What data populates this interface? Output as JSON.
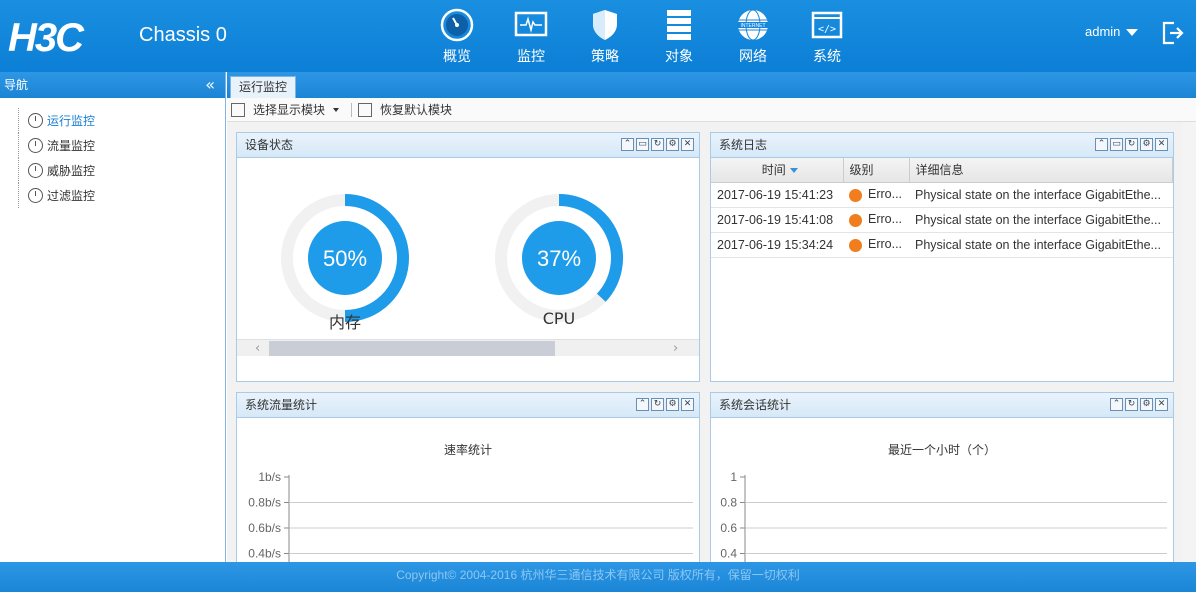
{
  "header": {
    "logo": "H3C",
    "chassis": "Chassis 0",
    "user": "admin",
    "nav": [
      {
        "label": "概览",
        "icon": "gauge-icon"
      },
      {
        "label": "监控",
        "icon": "monitor-icon"
      },
      {
        "label": "策略",
        "icon": "shield-icon"
      },
      {
        "label": "对象",
        "icon": "server-icon"
      },
      {
        "label": "网络",
        "icon": "internet-icon"
      },
      {
        "label": "系统",
        "icon": "code-window-icon"
      }
    ],
    "internet_icon_text": "INTERNET"
  },
  "sidebar": {
    "title": "导航",
    "collapse": "«",
    "items": [
      {
        "label": "运行监控",
        "active": true
      },
      {
        "label": "流量监控",
        "active": false
      },
      {
        "label": "威胁监控",
        "active": false
      },
      {
        "label": "过滤监控",
        "active": false
      }
    ]
  },
  "main": {
    "tab": "运行监控",
    "toolbar": {
      "select_modules": "选择显示模块",
      "restore_default": "恢复默认模块"
    }
  },
  "device_status": {
    "title": "设备状态",
    "gauges": [
      {
        "label": "内存",
        "value": 50,
        "text": "50%"
      },
      {
        "label": "CPU",
        "value": 37,
        "text": "37%"
      }
    ]
  },
  "system_log": {
    "title": "系统日志",
    "columns": [
      "时间",
      "级别",
      "详细信息"
    ],
    "rows": [
      {
        "time": "2017-06-19 15:41:23",
        "level": "Erro...",
        "detail": "Physical state on the interface GigabitEthe..."
      },
      {
        "time": "2017-06-19 15:41:08",
        "level": "Erro...",
        "detail": "Physical state on the interface GigabitEthe..."
      },
      {
        "time": "2017-06-19 15:34:24",
        "level": "Erro...",
        "detail": "Physical state on the interface GigabitEthe..."
      }
    ]
  },
  "traffic_stats": {
    "title": "系统流量统计",
    "chart_title": "速率统计",
    "ticks": [
      "1b/s",
      "0.8b/s",
      "0.6b/s",
      "0.4b/s"
    ]
  },
  "session_stats": {
    "title": "系统会话统计",
    "chart_title": "最近一个小时（个）",
    "ticks": [
      "1",
      "0.8",
      "0.6",
      "0.4"
    ]
  },
  "footer": "Copyright© 2004-2016 杭州华三通信技术有限公司 版权所有，保留一切权利",
  "colors": {
    "header_blue": "#1586dc",
    "gauge_blue": "#1e9be9",
    "error_orange": "#f07d1e"
  }
}
